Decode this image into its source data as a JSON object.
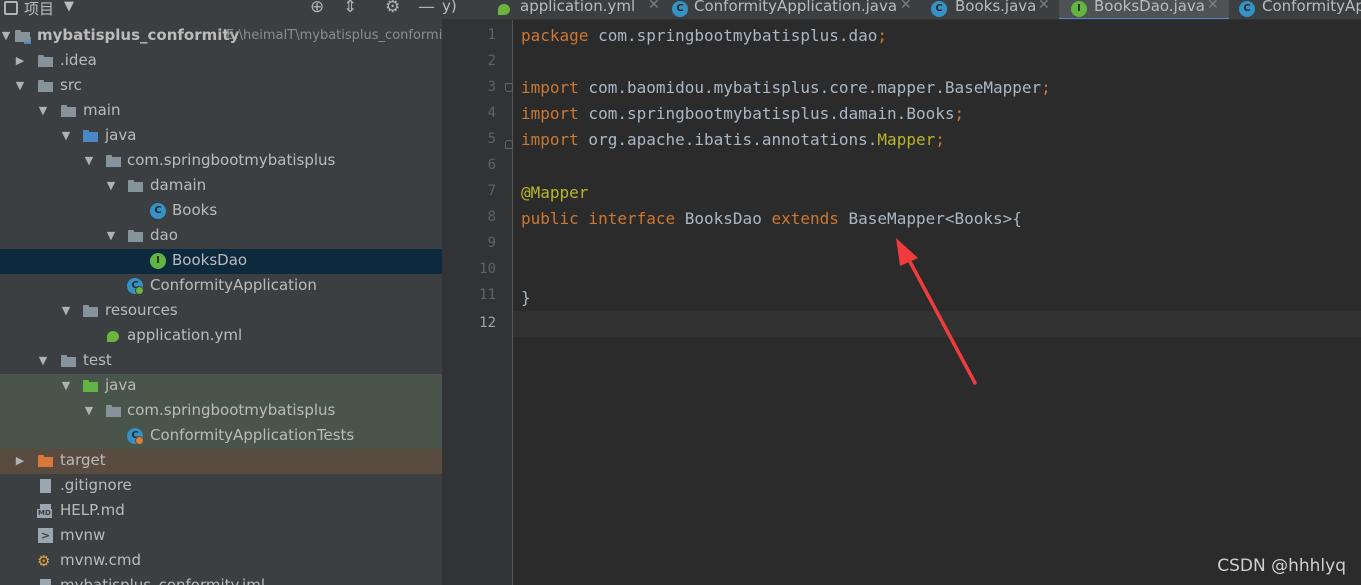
{
  "project_panel": {
    "title": "项目",
    "tree": [
      {
        "label": "mybatisplus_conformity",
        "path": "E:\\heimaIT\\mybatisplus_conformity",
        "icon": "module-folder-icon",
        "expanded": true
      },
      {
        "label": ".idea",
        "icon": "folder-icon",
        "expanded": false
      },
      {
        "label": "src",
        "icon": "folder-icon",
        "expanded": true
      },
      {
        "label": "main",
        "icon": "folder-icon",
        "expanded": true
      },
      {
        "label": "java",
        "icon": "source-folder-icon",
        "expanded": true
      },
      {
        "label": "com.springbootmybatisplus",
        "icon": "package-icon",
        "expanded": true
      },
      {
        "label": "damain",
        "icon": "package-icon",
        "expanded": true
      },
      {
        "label": "Books",
        "icon": "class-icon"
      },
      {
        "label": "dao",
        "icon": "package-icon",
        "expanded": true
      },
      {
        "label": "BooksDao",
        "icon": "interface-icon",
        "selected": true
      },
      {
        "label": "ConformityApplication",
        "icon": "spring-boot-class-icon"
      },
      {
        "label": "resources",
        "icon": "resources-folder-icon",
        "expanded": true
      },
      {
        "label": "application.yml",
        "icon": "spring-yml-icon"
      },
      {
        "label": "test",
        "icon": "folder-icon",
        "expanded": true
      },
      {
        "label": "java",
        "icon": "test-source-folder-icon",
        "expanded": true
      },
      {
        "label": "com.springbootmybatisplus",
        "icon": "package-icon",
        "expanded": true
      },
      {
        "label": "ConformityApplicationTests",
        "icon": "spring-test-class-icon"
      },
      {
        "label": "target",
        "icon": "excluded-folder-icon",
        "expanded": false
      },
      {
        "label": ".gitignore",
        "icon": "gitignore-file-icon"
      },
      {
        "label": "HELP.md",
        "icon": "markdown-file-icon"
      },
      {
        "label": "mvnw",
        "icon": "shell-script-icon"
      },
      {
        "label": "mvnw.cmd",
        "icon": "cmd-script-icon"
      },
      {
        "label": "mybatisplus_conformity.iml",
        "icon": "iml-file-icon"
      }
    ]
  },
  "tabs": [
    {
      "label": "y)",
      "icon": ""
    },
    {
      "label": "application.yml",
      "icon": "spring-yml-icon"
    },
    {
      "label": "ConformityApplication.java",
      "icon": "spring-boot-class-icon"
    },
    {
      "label": "Books.java",
      "icon": "class-icon"
    },
    {
      "label": "BooksDao.java",
      "icon": "interface-icon",
      "active": true
    },
    {
      "label": "ConformityAp",
      "icon": "spring-boot-class-icon"
    }
  ],
  "editor": {
    "current_line": 12,
    "line_numbers": [
      "1",
      "2",
      "3",
      "4",
      "5",
      "6",
      "7",
      "8",
      "9",
      "10",
      "11",
      "12"
    ],
    "lines": [
      {
        "k1": "package",
        "p1": " com.springbootmybatisplus.dao",
        "k2": ";"
      },
      {},
      {
        "k1": "import",
        "p1": " com.baomidou.mybatisplus.core.mapper.BaseMapper",
        "k2": ";"
      },
      {
        "k1": "import",
        "p1": " com.springbootmybatisplus.damain.Books",
        "k2": ";"
      },
      {
        "k1": "import",
        "p1": " org.apache.ibatis.annotations.",
        "a1": "Mapper",
        "k2": ";"
      },
      {},
      {
        "a1": "@Mapper"
      },
      {
        "k1": "public interface",
        "p1": " BooksDao ",
        "k2": "extends",
        "p2": " BaseMapper<Books>{"
      },
      {},
      {},
      {
        "p1": "}"
      },
      {}
    ]
  },
  "watermark": "CSDN @hhhlyq",
  "colors": {
    "keyword": "#cc7832",
    "annotation": "#bbb529",
    "text": "#a9b7c6",
    "arrow": "#f03c3c"
  }
}
